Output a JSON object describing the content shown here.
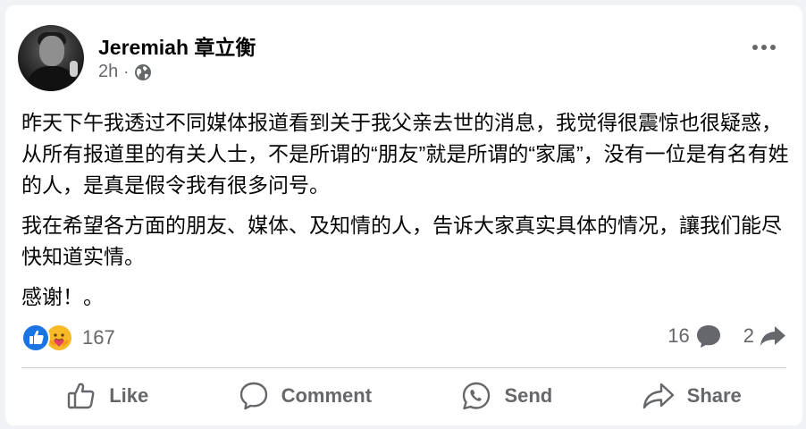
{
  "post": {
    "author": "Jeremiah 章立衡",
    "time": "2h",
    "separator": "·",
    "paragraphs": [
      "昨天下午我透过不同媒体报道看到关于我父亲去世的消息，我觉得很震惊也很疑惑，从所有报道里的有关人士，不是所谓的“朋友”就是所谓的“家属”，没有一位是有名有姓的人，是真是假令我有很多问号。",
      "我在希望各方面的朋友、媒体、及知情的人，告诉大家真实具体的情况，讓我们能尽快知道实情。",
      "感谢！。"
    ]
  },
  "reactions": {
    "count": "167",
    "icons": [
      "like-reaction-icon",
      "care-reaction-icon"
    ]
  },
  "stats": {
    "comments": "16",
    "shares": "2"
  },
  "actions": {
    "like": "Like",
    "comment": "Comment",
    "send": "Send",
    "share": "Share"
  },
  "colors": {
    "like_blue": "#1b74e4",
    "care_yellow": "#f7b928",
    "secondary_text": "#65676b"
  }
}
